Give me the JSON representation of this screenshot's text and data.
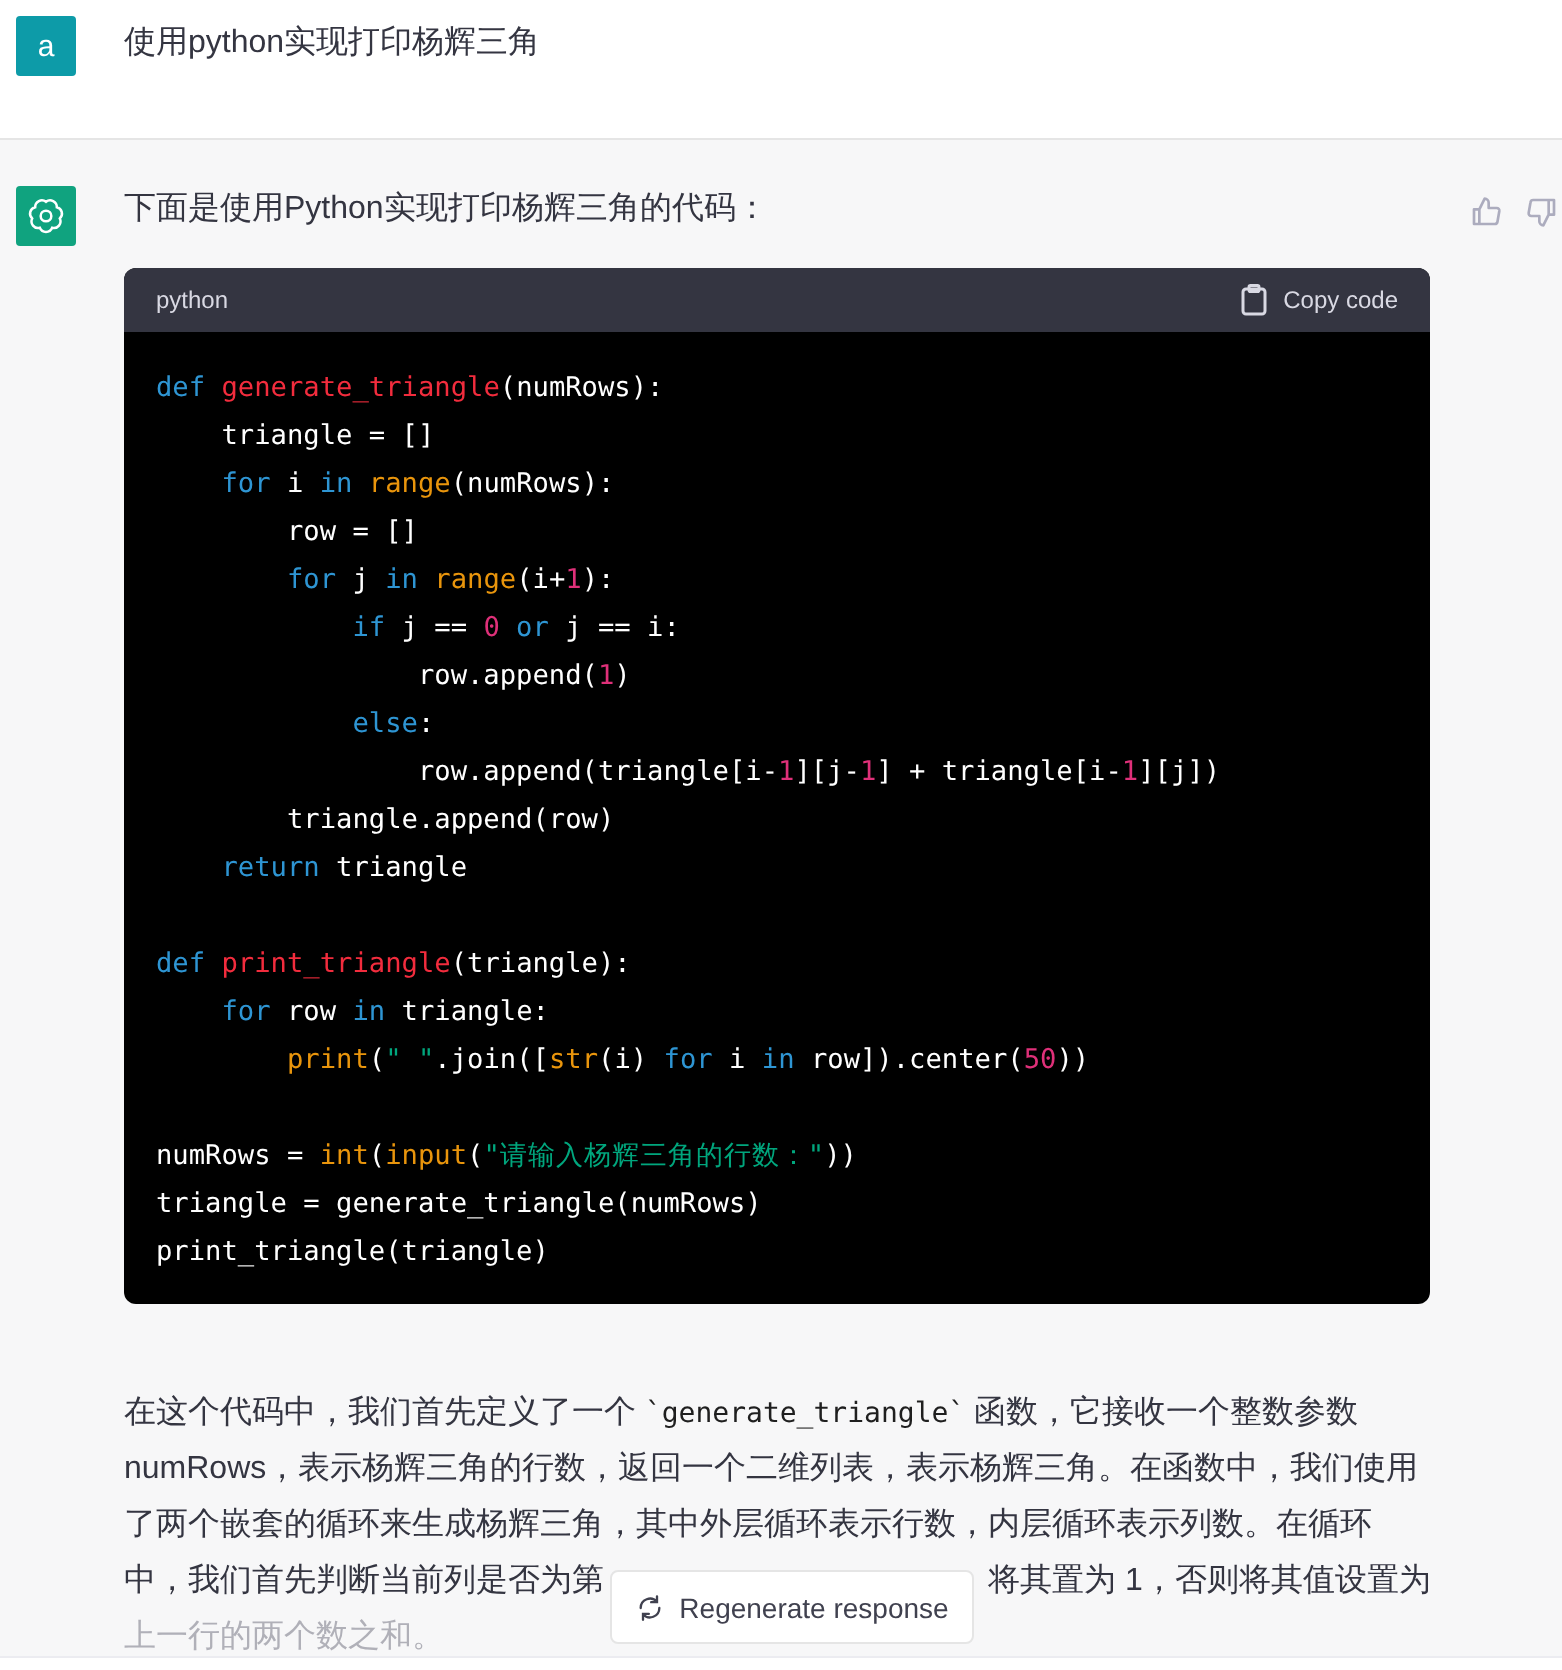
{
  "user_message": {
    "avatar": "a",
    "text": "使用python实现打印杨辉三角"
  },
  "assistant_message": {
    "intro": "下面是使用Python实现打印杨辉三角的代码：",
    "code_block": {
      "language": "python",
      "copy_label": "Copy code",
      "blocks": [
        [
          [
            {
              "t": "def ",
              "kind": "keyword"
            },
            {
              "t": "generate_triangle",
              "kind": "title"
            },
            {
              "t": "(numRows):",
              "kind": "plain"
            }
          ],
          [
            {
              "t": "    triangle = []",
              "kind": "plain"
            }
          ],
          [
            {
              "t": "    for",
              "kind": "keyword"
            },
            {
              "t": " i ",
              "kind": "plain"
            },
            {
              "t": "in ",
              "kind": "keyword"
            },
            {
              "t": "range",
              "kind": "builtin"
            },
            {
              "t": "(numRows):",
              "kind": "plain"
            }
          ],
          [
            {
              "t": "        row = []",
              "kind": "plain"
            }
          ],
          [
            {
              "t": "        for",
              "kind": "keyword"
            },
            {
              "t": " j ",
              "kind": "plain"
            },
            {
              "t": "in ",
              "kind": "keyword"
            },
            {
              "t": "range",
              "kind": "builtin"
            },
            {
              "t": "(i+",
              "kind": "plain"
            },
            {
              "t": "1",
              "kind": "number"
            },
            {
              "t": "):",
              "kind": "plain"
            }
          ],
          [
            {
              "t": "            if",
              "kind": "keyword"
            },
            {
              "t": " j == ",
              "kind": "plain"
            },
            {
              "t": "0",
              "kind": "number"
            },
            {
              "t": " or",
              "kind": "keyword"
            },
            {
              "t": " j == i:",
              "kind": "plain"
            }
          ],
          [
            {
              "t": "                row.append(",
              "kind": "plain"
            },
            {
              "t": "1",
              "kind": "number"
            },
            {
              "t": ")",
              "kind": "plain"
            }
          ],
          [
            {
              "t": "            else",
              "kind": "keyword"
            },
            {
              "t": ":",
              "kind": "plain"
            }
          ],
          [
            {
              "t": "                row.append(triangle[i-",
              "kind": "plain"
            },
            {
              "t": "1",
              "kind": "number"
            },
            {
              "t": "][j-",
              "kind": "plain"
            },
            {
              "t": "1",
              "kind": "number"
            },
            {
              "t": "] + triangle[i-",
              "kind": "plain"
            },
            {
              "t": "1",
              "kind": "number"
            },
            {
              "t": "][j])",
              "kind": "plain"
            }
          ],
          [
            {
              "t": "        triangle.append(row)",
              "kind": "plain"
            }
          ],
          [
            {
              "t": "    return",
              "kind": "keyword"
            },
            {
              "t": " triangle",
              "kind": "plain"
            }
          ]
        ],
        [
          [
            {
              "t": "def ",
              "kind": "keyword"
            },
            {
              "t": "print_triangle",
              "kind": "title"
            },
            {
              "t": "(triangle):",
              "kind": "plain"
            }
          ],
          [
            {
              "t": "    for",
              "kind": "keyword"
            },
            {
              "t": " row ",
              "kind": "plain"
            },
            {
              "t": "in",
              "kind": "keyword"
            },
            {
              "t": " triangle:",
              "kind": "plain"
            }
          ],
          [
            {
              "t": "        print",
              "kind": "builtin"
            },
            {
              "t": "(",
              "kind": "plain"
            },
            {
              "t": "\" \"",
              "kind": "string"
            },
            {
              "t": ".join([",
              "kind": "plain"
            },
            {
              "t": "str",
              "kind": "builtin"
            },
            {
              "t": "(i) ",
              "kind": "plain"
            },
            {
              "t": "for",
              "kind": "keyword"
            },
            {
              "t": " i ",
              "kind": "plain"
            },
            {
              "t": "in",
              "kind": "keyword"
            },
            {
              "t": " row]).center(",
              "kind": "plain"
            },
            {
              "t": "50",
              "kind": "number"
            },
            {
              "t": "))",
              "kind": "plain"
            }
          ]
        ],
        [
          [
            {
              "t": "numRows = ",
              "kind": "plain"
            },
            {
              "t": "int",
              "kind": "builtin"
            },
            {
              "t": "(",
              "kind": "plain"
            },
            {
              "t": "input",
              "kind": "builtin"
            },
            {
              "t": "(",
              "kind": "plain"
            },
            {
              "t": "\"请输入杨辉三角的行数：\"",
              "kind": "string"
            },
            {
              "t": "))",
              "kind": "plain"
            }
          ],
          [
            {
              "t": "triangle = generate_triangle(numRows)",
              "kind": "plain"
            }
          ],
          [
            {
              "t": "print_triangle(triangle)",
              "kind": "plain"
            }
          ]
        ]
      ]
    },
    "explanation_lines": [
      [
        {
          "t": "在这个代码中，我们首先定义了一个 ",
          "kind": "text"
        },
        {
          "t": "`generate_triangle`",
          "kind": "code"
        },
        {
          "t": " 函数，它接收一个整数参数",
          "kind": "text"
        }
      ],
      [
        {
          "t": "numRows，表示杨辉三角的行数，返回一个二维列表，表示杨辉三角。在函数中，我们使用",
          "kind": "text"
        }
      ],
      [
        {
          "t": "了两个嵌套的循环来生成杨辉三角，其中外层循环表示行数，内层循环表示列数。在循环",
          "kind": "text"
        }
      ],
      [
        {
          "t": "中，我们首先判断当前列是否为第",
          "kind": "text"
        },
        {
          "t": "将其置为 1，否则将其值设置为",
          "kind": "after_cover"
        }
      ],
      [
        {
          "t": "上一行的两个数之和。",
          "kind": "faded"
        }
      ]
    ]
  },
  "regenerate_button": {
    "label": "Regenerate response"
  }
}
